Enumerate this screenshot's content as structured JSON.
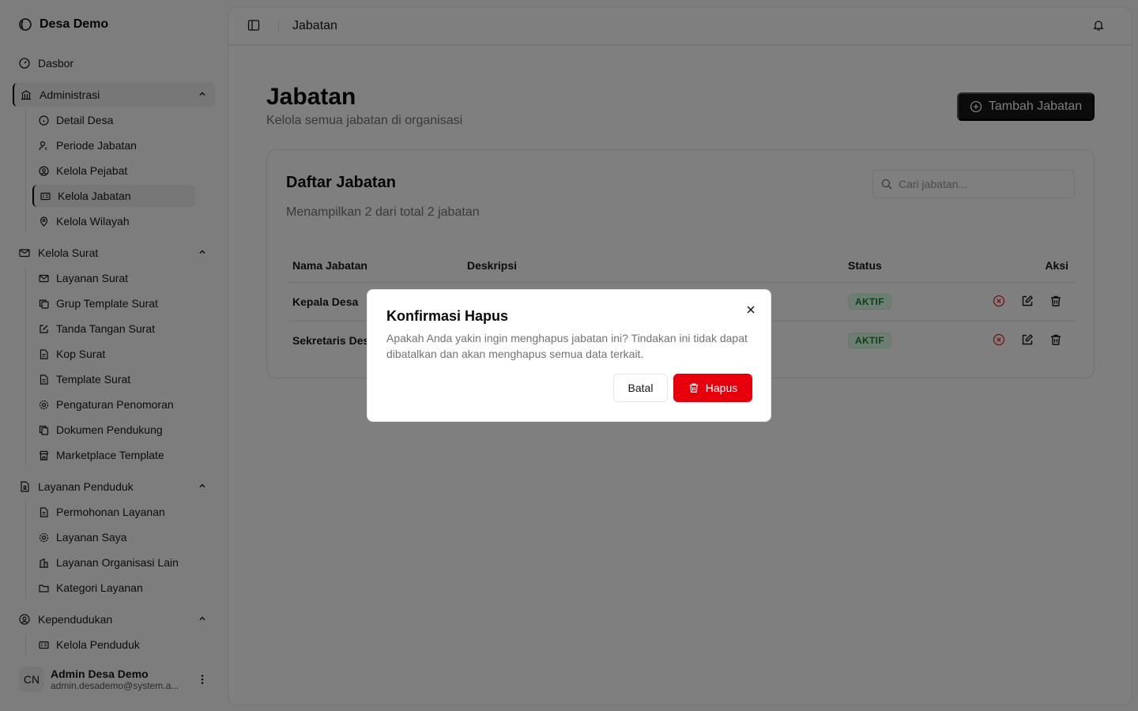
{
  "sidebar": {
    "brand": "Desa Demo",
    "dasbor": "Dasbor",
    "groups": [
      {
        "label": "Administrasi",
        "items": [
          "Detail Desa",
          "Periode Jabatan",
          "Kelola Pejabat",
          "Kelola Jabatan",
          "Kelola Wilayah"
        ]
      },
      {
        "label": "Kelola Surat",
        "items": [
          "Layanan Surat",
          "Grup Template Surat",
          "Tanda Tangan Surat",
          "Kop Surat",
          "Template Surat",
          "Pengaturan Penomoran",
          "Dokumen Pendukung",
          "Marketplace Template"
        ]
      },
      {
        "label": "Layanan Penduduk",
        "items": [
          "Permohonan Layanan",
          "Layanan Saya",
          "Layanan Organisasi Lain",
          "Kategori Layanan"
        ]
      },
      {
        "label": "Kependudukan",
        "items": [
          "Kelola Penduduk"
        ]
      }
    ],
    "user": {
      "initials": "CN",
      "name": "Admin Desa Demo",
      "email": "admin.desademo@system.a..."
    }
  },
  "header": {
    "breadcrumb": "Jabatan"
  },
  "page": {
    "title": "Jabatan",
    "subtitle": "Kelola semua jabatan di organisasi",
    "add_button": "Tambah Jabatan"
  },
  "card": {
    "title": "Daftar Jabatan",
    "description": "Menampilkan 2 dari total 2 jabatan",
    "search_placeholder": "Cari jabatan...",
    "columns": [
      "Nama Jabatan",
      "Deskripsi",
      "Status",
      "Aksi"
    ],
    "rows": [
      {
        "name": "Kepala Desa",
        "status": "AKTIF"
      },
      {
        "name": "Sekretaris Desa",
        "status": "AKTIF"
      }
    ]
  },
  "dialog": {
    "title": "Konfirmasi Hapus",
    "body": "Apakah Anda yakin ingin menghapus jabatan ini? Tindakan ini tidak dapat dibatalkan dan akan menghapus semua data terkait.",
    "cancel": "Batal",
    "confirm": "Hapus"
  },
  "colors": {
    "primary": "#171717",
    "danger": "#e7000b",
    "success": "#15803d"
  }
}
